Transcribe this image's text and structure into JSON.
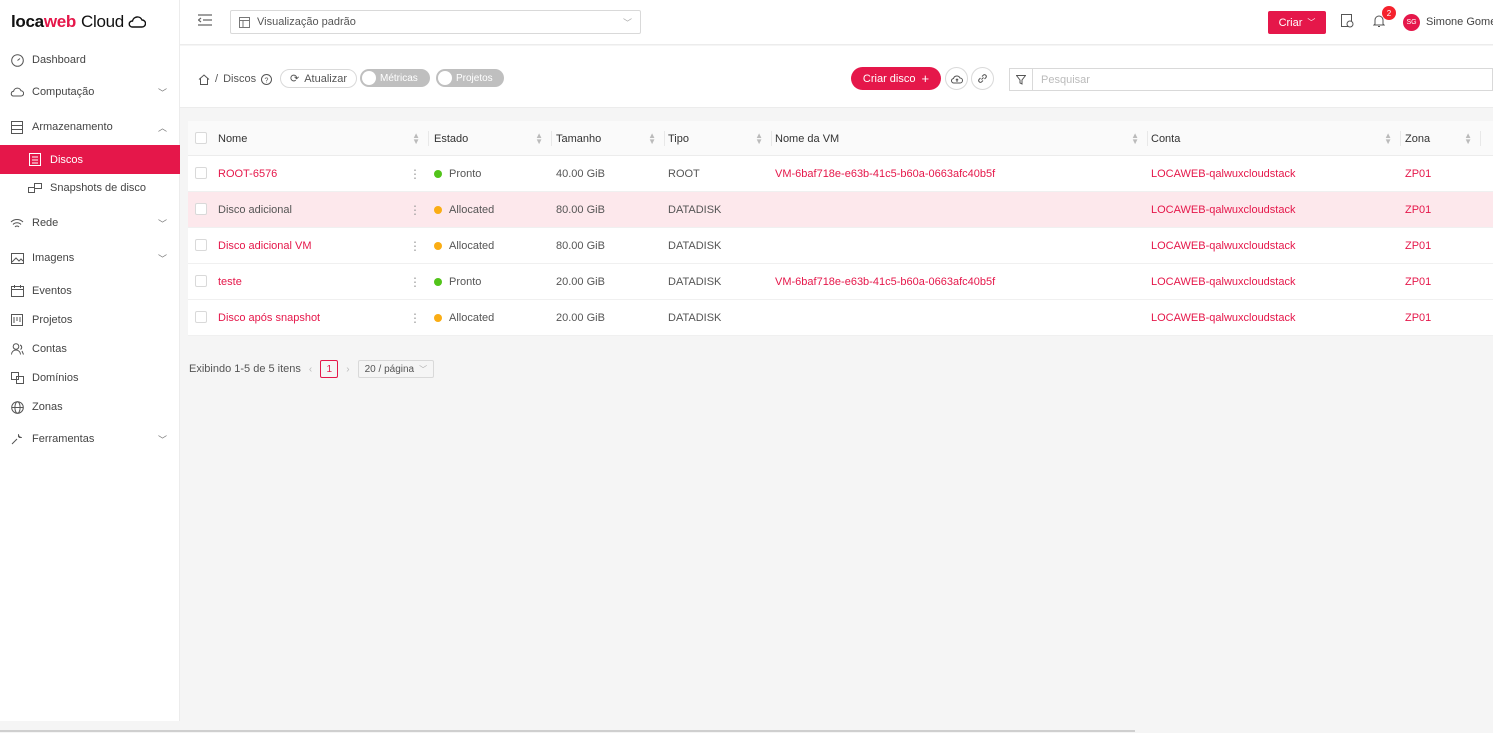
{
  "brand": {
    "part1": "loca",
    "part2": "web",
    "part3": "Cloud"
  },
  "sidebar": {
    "items": [
      {
        "label": "Dashboard",
        "icon": "dashboard-icon"
      },
      {
        "label": "Computação",
        "icon": "cloud-icon",
        "expandable": true
      },
      {
        "label": "Armazenamento",
        "icon": "storage-icon",
        "expanded": true
      },
      {
        "label": "Discos",
        "icon": "disk-icon",
        "active": true
      },
      {
        "label": "Snapshots de disco",
        "icon": "snapshot-icon"
      },
      {
        "label": "Rede",
        "icon": "wifi-icon",
        "expandable": true
      },
      {
        "label": "Imagens",
        "icon": "image-icon",
        "expandable": true
      },
      {
        "label": "Eventos",
        "icon": "calendar-icon"
      },
      {
        "label": "Projetos",
        "icon": "project-icon"
      },
      {
        "label": "Contas",
        "icon": "users-icon"
      },
      {
        "label": "Domínios",
        "icon": "domain-icon"
      },
      {
        "label": "Zonas",
        "icon": "globe-icon"
      },
      {
        "label": "Ferramentas",
        "icon": "tool-icon",
        "expandable": true
      }
    ]
  },
  "header": {
    "view_select": "Visualização padrão",
    "create_label": "Criar",
    "notifications_count": "2",
    "avatar_initials": "SG",
    "username": "Simone Gomes"
  },
  "toolbar": {
    "breadcrumb_current": "Discos",
    "refresh_label": "Atualizar",
    "metrics_label": "Métricas",
    "projects_label": "Projetos",
    "create_disk_label": "Criar disco",
    "search_placeholder": "Pesquisar"
  },
  "table": {
    "columns": [
      "Nome",
      "Estado",
      "Tamanho",
      "Tipo",
      "Nome da VM",
      "Conta",
      "Zona"
    ],
    "rows": [
      {
        "name": "ROOT-6576",
        "state": "Pronto",
        "state_color": "#52c41a",
        "size": "40.00 GiB",
        "type": "ROOT",
        "vm": "VM-6baf718e-e63b-41c5-b60a-0663afc40b5f",
        "account": "LOCAWEB-qalwuxcloudstack",
        "zone": "ZP01",
        "highlight": false,
        "name_link": true
      },
      {
        "name": "Disco adicional",
        "state": "Allocated",
        "state_color": "#faad14",
        "size": "80.00 GiB",
        "type": "DATADISK",
        "vm": "",
        "account": "LOCAWEB-qalwuxcloudstack",
        "zone": "ZP01",
        "highlight": true,
        "name_link": false
      },
      {
        "name": "Disco adicional VM",
        "state": "Allocated",
        "state_color": "#faad14",
        "size": "80.00 GiB",
        "type": "DATADISK",
        "vm": "",
        "account": "LOCAWEB-qalwuxcloudstack",
        "zone": "ZP01",
        "highlight": false,
        "name_link": true
      },
      {
        "name": "teste",
        "state": "Pronto",
        "state_color": "#52c41a",
        "size": "20.00 GiB",
        "type": "DATADISK",
        "vm": "VM-6baf718e-e63b-41c5-b60a-0663afc40b5f",
        "account": "LOCAWEB-qalwuxcloudstack",
        "zone": "ZP01",
        "highlight": false,
        "name_link": true
      },
      {
        "name": "Disco após snapshot",
        "state": "Allocated",
        "state_color": "#faad14",
        "size": "20.00 GiB",
        "type": "DATADISK",
        "vm": "",
        "account": "LOCAWEB-qalwuxcloudstack",
        "zone": "ZP01",
        "highlight": false,
        "name_link": true
      }
    ]
  },
  "pagination": {
    "summary": "Exibindo 1-5 de 5 itens",
    "current_page": "1",
    "page_size": "20 / página"
  },
  "colors": {
    "accent": "#e5174a"
  }
}
